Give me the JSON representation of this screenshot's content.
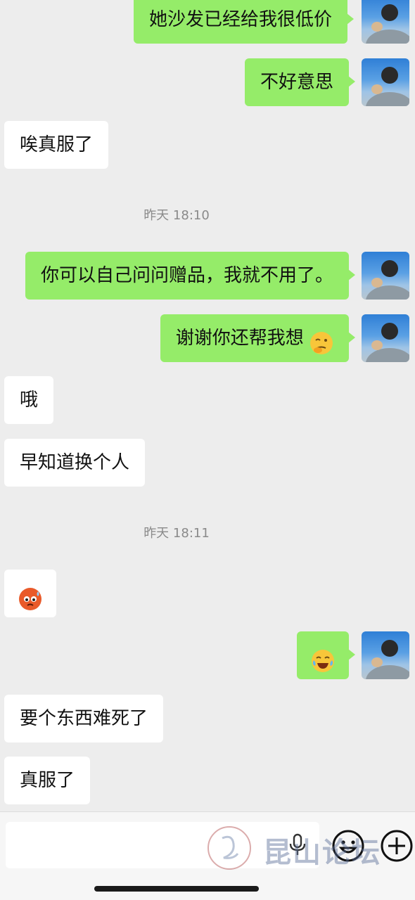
{
  "messages": [
    {
      "side": "me",
      "text": "她沙发已经给我很低价"
    },
    {
      "side": "me",
      "text": "不好意思"
    },
    {
      "side": "them",
      "text": "唉真服了"
    },
    {
      "side": "time",
      "text": "昨天 18:10"
    },
    {
      "side": "me",
      "text": "你可以自己问问赠品，我就不用了。"
    },
    {
      "side": "me",
      "text": "谢谢你还帮我想",
      "emoji": "thinking-face-emoji"
    },
    {
      "side": "them",
      "text": "哦"
    },
    {
      "side": "them",
      "text": "早知道换个人"
    },
    {
      "side": "time",
      "text": "昨天 18:11"
    },
    {
      "side": "them",
      "emoji": "sweating-red-face-emoji"
    },
    {
      "side": "me",
      "emoji": "tears-of-joy-emoji"
    },
    {
      "side": "them",
      "text": "要个东西难死了"
    },
    {
      "side": "them",
      "text": "真服了"
    }
  ],
  "composer": {
    "voice_icon": "microphone-icon",
    "emoji_icon": "smiley-icon",
    "more_icon": "plus-icon"
  },
  "watermark": {
    "text": "昆山论坛"
  },
  "colors": {
    "my_bubble": "#95ec69",
    "their_bubble": "#ffffff",
    "background": "#ededed"
  }
}
